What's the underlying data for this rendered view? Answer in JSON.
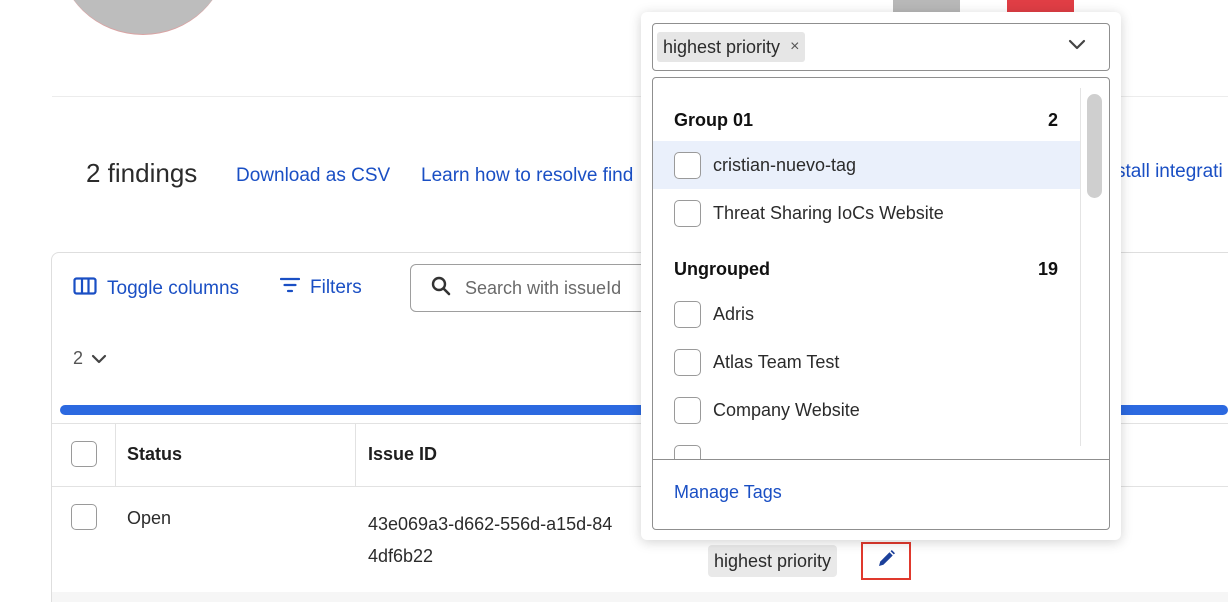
{
  "findings": {
    "count_label": "2 findings",
    "download_csv": "Download as CSV",
    "learn_link": "Learn how to resolve find",
    "install_link": "stall integrati"
  },
  "toolbar": {
    "toggle_columns": "Toggle columns",
    "filters": "Filters",
    "search_placeholder": "Search with issueId"
  },
  "pagination": {
    "page_size": "2"
  },
  "progress": {
    "percent": 100,
    "color": "#2c69e0"
  },
  "table": {
    "headers": [
      "Status",
      "Issue ID"
    ],
    "rows": [
      {
        "status": "Open",
        "issue_id_line1": "43e069a3-d662-556d-a15d-84",
        "issue_id_line2": "4df6b22",
        "tag": "highest priority"
      }
    ]
  },
  "tag_dropdown": {
    "selected": [
      {
        "label": "highest priority",
        "remove": "×"
      }
    ],
    "groups": [
      {
        "name": "Group 01",
        "count": "2",
        "options": [
          {
            "label": "cristian-nuevo-tag",
            "checked": false,
            "highlighted": true
          },
          {
            "label": "Threat Sharing IoCs Website",
            "checked": false,
            "highlighted": false
          }
        ]
      },
      {
        "name": "Ungrouped",
        "count": "19",
        "options": [
          {
            "label": "Adris",
            "checked": false
          },
          {
            "label": "Atlas Team Test",
            "checked": false
          },
          {
            "label": "Company Website",
            "checked": false
          }
        ]
      }
    ],
    "manage_tags": "Manage Tags"
  },
  "colors": {
    "link": "#1a4fc4",
    "accent_bar": "#2c69e0",
    "edit_highlight": "#e0392d",
    "red_button": "#e03e45"
  },
  "icons": [
    "toggle-columns-icon",
    "filter-icon",
    "search-icon",
    "chevron-down-icon",
    "pencil-icon",
    "close-icon"
  ]
}
